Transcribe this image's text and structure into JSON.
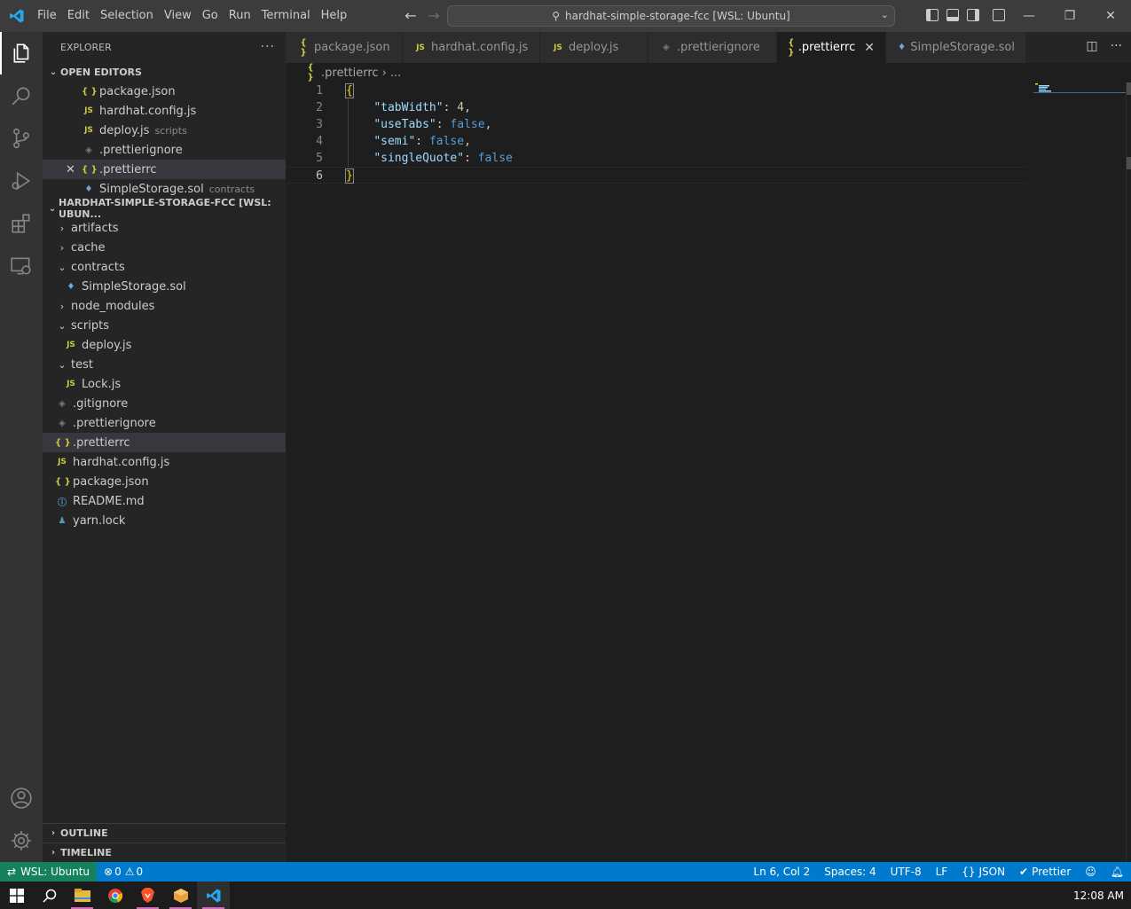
{
  "titlebar": {
    "menu": [
      "File",
      "Edit",
      "Selection",
      "View",
      "Go",
      "Run",
      "Terminal",
      "Help"
    ],
    "command_center": "hardhat-simple-storage-fcc [WSL: Ubuntu]"
  },
  "sidebar": {
    "title": "EXPLORER",
    "more": "···",
    "open_editors_title": "OPEN EDITORS",
    "open_editors": [
      {
        "name": "package.json",
        "icon": "{ }",
        "type": "json",
        "desc": ""
      },
      {
        "name": "hardhat.config.js",
        "icon": "JS",
        "type": "js",
        "desc": ""
      },
      {
        "name": "deploy.js",
        "icon": "JS",
        "type": "js",
        "desc": "scripts"
      },
      {
        "name": ".prettierignore",
        "icon": "◈",
        "type": "ignore",
        "desc": ""
      },
      {
        "name": ".prettierrc",
        "icon": "{ }",
        "type": "json",
        "desc": ""
      },
      {
        "name": "SimpleStorage.sol",
        "icon": "♦",
        "type": "sol",
        "desc": "contracts"
      }
    ],
    "workspace_title": "HARDHAT-SIMPLE-STORAGE-FCC [WSL: UBUN...",
    "tree": [
      {
        "name": "artifacts",
        "chev": "›",
        "icon": "",
        "type": "folder"
      },
      {
        "name": "cache",
        "chev": "›",
        "icon": "",
        "type": "folder"
      },
      {
        "name": "contracts",
        "chev": "⌄",
        "icon": "",
        "type": "folder"
      },
      {
        "name": "SimpleStorage.sol",
        "chev": "",
        "icon": "♦",
        "type": "sol"
      },
      {
        "name": "node_modules",
        "chev": "›",
        "icon": "",
        "type": "folder"
      },
      {
        "name": "scripts",
        "chev": "⌄",
        "icon": "",
        "type": "folder"
      },
      {
        "name": "deploy.js",
        "chev": "",
        "icon": "JS",
        "type": "js"
      },
      {
        "name": "test",
        "chev": "⌄",
        "icon": "",
        "type": "folder"
      },
      {
        "name": "Lock.js",
        "chev": "",
        "icon": "JS",
        "type": "js"
      },
      {
        "name": ".gitignore",
        "chev": "",
        "icon": "◈",
        "type": "ignore"
      },
      {
        "name": ".prettierignore",
        "chev": "",
        "icon": "◈",
        "type": "ignore"
      },
      {
        "name": ".prettierrc",
        "chev": "",
        "icon": "{ }",
        "type": "json"
      },
      {
        "name": "hardhat.config.js",
        "chev": "",
        "icon": "JS",
        "type": "js"
      },
      {
        "name": "package.json",
        "chev": "",
        "icon": "{ }",
        "type": "json"
      },
      {
        "name": "README.md",
        "chev": "",
        "icon": "ⓘ",
        "type": "info"
      },
      {
        "name": "yarn.lock",
        "chev": "",
        "icon": "♟",
        "type": "yarn"
      }
    ],
    "outline": "OUTLINE",
    "timeline": "TIMELINE"
  },
  "tabs": [
    {
      "label": "package.json",
      "icon": "{ }",
      "type": "json"
    },
    {
      "label": "hardhat.config.js",
      "icon": "JS",
      "type": "js"
    },
    {
      "label": "deploy.js",
      "icon": "JS",
      "type": "js"
    },
    {
      "label": ".prettierignore",
      "icon": "◈",
      "type": "ignore"
    },
    {
      "label": ".prettierrc",
      "icon": "{ }",
      "type": "json",
      "active": true
    },
    {
      "label": "SimpleStorage.sol",
      "icon": "♦",
      "type": "sol"
    }
  ],
  "breadcrumb": {
    "icon": "{ }",
    "file": ".prettierrc",
    "rest": "› ..."
  },
  "editor": {
    "lines": [
      {
        "n": "1",
        "tokens": [
          [
            "brace",
            "{"
          ]
        ]
      },
      {
        "n": "2",
        "tokens": [
          [
            "punc",
            "    "
          ],
          [
            "key",
            "\"tabWidth\""
          ],
          [
            "punc",
            ": "
          ],
          [
            "num",
            "4"
          ],
          [
            "punc",
            ","
          ]
        ]
      },
      {
        "n": "3",
        "tokens": [
          [
            "punc",
            "    "
          ],
          [
            "key",
            "\"useTabs\""
          ],
          [
            "punc",
            ": "
          ],
          [
            "bool",
            "false"
          ],
          [
            "punc",
            ","
          ]
        ]
      },
      {
        "n": "4",
        "tokens": [
          [
            "punc",
            "    "
          ],
          [
            "key",
            "\"semi\""
          ],
          [
            "punc",
            ": "
          ],
          [
            "bool",
            "false"
          ],
          [
            "punc",
            ","
          ]
        ]
      },
      {
        "n": "5",
        "tokens": [
          [
            "punc",
            "    "
          ],
          [
            "key",
            "\"singleQuote\""
          ],
          [
            "punc",
            ": "
          ],
          [
            "bool",
            "false"
          ]
        ]
      },
      {
        "n": "6",
        "tokens": [
          [
            "brace",
            "}"
          ]
        ]
      }
    ],
    "current_line": 6
  },
  "statusbar": {
    "remote": "WSL: Ubuntu",
    "errors": "0",
    "warnings": "0",
    "position": "Ln 6, Col 2",
    "spaces": "Spaces: 4",
    "encoding": "UTF-8",
    "eol": "LF",
    "language": "JSON",
    "formatter": "Prettier"
  },
  "taskbar": {
    "apps": [
      "windows-start",
      "search",
      "file-explorer",
      "chrome",
      "brave",
      "wsl-terminal",
      "vscode"
    ],
    "clock": "12:08 AM"
  },
  "colors": {
    "accent": "#007acc",
    "remote": "#16825d",
    "json_icon": "#cbcb41",
    "sol_icon": "#6ea6e0"
  }
}
